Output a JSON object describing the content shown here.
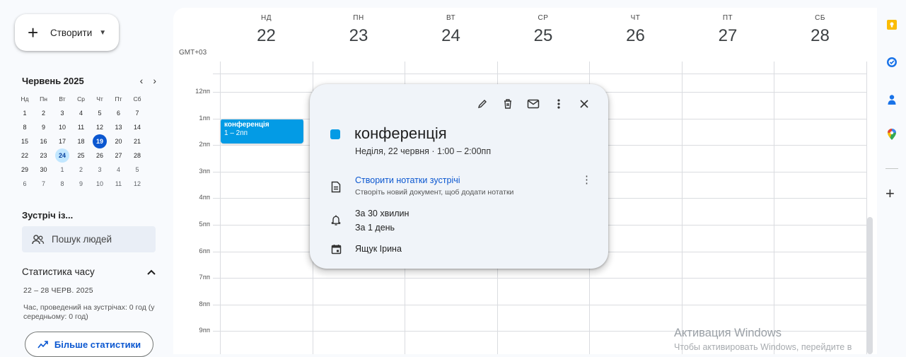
{
  "create": {
    "label": "Створити",
    "plus": "+",
    "caret": "▼"
  },
  "mini_calendar": {
    "title": "Червень 2025",
    "prev": "‹",
    "next": "›",
    "weekdays": [
      "Нд",
      "Пн",
      "Вт",
      "Ср",
      "Чт",
      "Пт",
      "Сб"
    ],
    "weeks": [
      [
        {
          "d": "1",
          "o": false
        },
        {
          "d": "2",
          "o": false
        },
        {
          "d": "3",
          "o": false
        },
        {
          "d": "4",
          "o": false
        },
        {
          "d": "5",
          "o": false
        },
        {
          "d": "6",
          "o": false
        },
        {
          "d": "7",
          "o": false
        }
      ],
      [
        {
          "d": "8",
          "o": false
        },
        {
          "d": "9",
          "o": false
        },
        {
          "d": "10",
          "o": false
        },
        {
          "d": "11",
          "o": false
        },
        {
          "d": "12",
          "o": false
        },
        {
          "d": "13",
          "o": false
        },
        {
          "d": "14",
          "o": false
        }
      ],
      [
        {
          "d": "15",
          "o": false
        },
        {
          "d": "16",
          "o": false
        },
        {
          "d": "17",
          "o": false
        },
        {
          "d": "18",
          "o": false
        },
        {
          "d": "19",
          "o": false,
          "today": true
        },
        {
          "d": "20",
          "o": false
        },
        {
          "d": "21",
          "o": false
        }
      ],
      [
        {
          "d": "22",
          "o": false
        },
        {
          "d": "23",
          "o": false
        },
        {
          "d": "24",
          "o": false,
          "sel": true
        },
        {
          "d": "25",
          "o": false
        },
        {
          "d": "26",
          "o": false
        },
        {
          "d": "27",
          "o": false
        },
        {
          "d": "28",
          "o": false
        }
      ],
      [
        {
          "d": "29",
          "o": false
        },
        {
          "d": "30",
          "o": false
        },
        {
          "d": "1",
          "o": true
        },
        {
          "d": "2",
          "o": true
        },
        {
          "d": "3",
          "o": true
        },
        {
          "d": "4",
          "o": true
        },
        {
          "d": "5",
          "o": true
        }
      ],
      [
        {
          "d": "6",
          "o": true
        },
        {
          "d": "7",
          "o": true
        },
        {
          "d": "8",
          "o": true
        },
        {
          "d": "9",
          "o": true
        },
        {
          "d": "10",
          "o": true
        },
        {
          "d": "11",
          "o": true
        },
        {
          "d": "12",
          "o": true
        }
      ]
    ]
  },
  "meet": {
    "title": "Зустріч із...",
    "search_label": "Пошук людей"
  },
  "stats": {
    "title": "Статистика часу",
    "caret": "^",
    "range": "22 – 28 ЧЕРВ. 2025",
    "text": "Час, проведений на зустрічах: 0 год (у середньому: 0 год)",
    "more_label": "Більше статистики"
  },
  "week": {
    "timezone": "GMT+03",
    "days": [
      {
        "name": "НД",
        "num": "22"
      },
      {
        "name": "ПН",
        "num": "23"
      },
      {
        "name": "ВТ",
        "num": "24"
      },
      {
        "name": "СР",
        "num": "25"
      },
      {
        "name": "ЧТ",
        "num": "26"
      },
      {
        "name": "ПТ",
        "num": "27"
      },
      {
        "name": "СБ",
        "num": "28"
      }
    ],
    "hours": [
      "12пп",
      "1пп",
      "2пп",
      "3пп",
      "4пп",
      "5пп",
      "6пп",
      "7пп",
      "8пп",
      "9пп"
    ]
  },
  "event": {
    "title": "конференція",
    "time": "1 – 2пп",
    "color": "#039be5"
  },
  "popup": {
    "title": "конференція",
    "date": "Неділя, 22 червня  ·  1:00 – 2:00пп",
    "notes_link": "Створити нотатки зустрічі",
    "notes_sub": "Створіть новий документ, щоб додати нотатки",
    "more": "⋮",
    "reminder1": "За 30 хвилин",
    "reminder2": "За 1 день",
    "owner": "Ящук Ірина",
    "tools": [
      "edit-icon",
      "delete-icon",
      "email-icon",
      "more-vert-icon",
      "close-icon"
    ]
  },
  "rail": {
    "plus": "+",
    "icons": [
      "keep-icon",
      "tasks-icon",
      "contacts-icon",
      "maps-icon"
    ]
  },
  "watermark": {
    "line1": "Активация Windows",
    "line2": "Чтобы активировать Windows, перейдите в"
  }
}
